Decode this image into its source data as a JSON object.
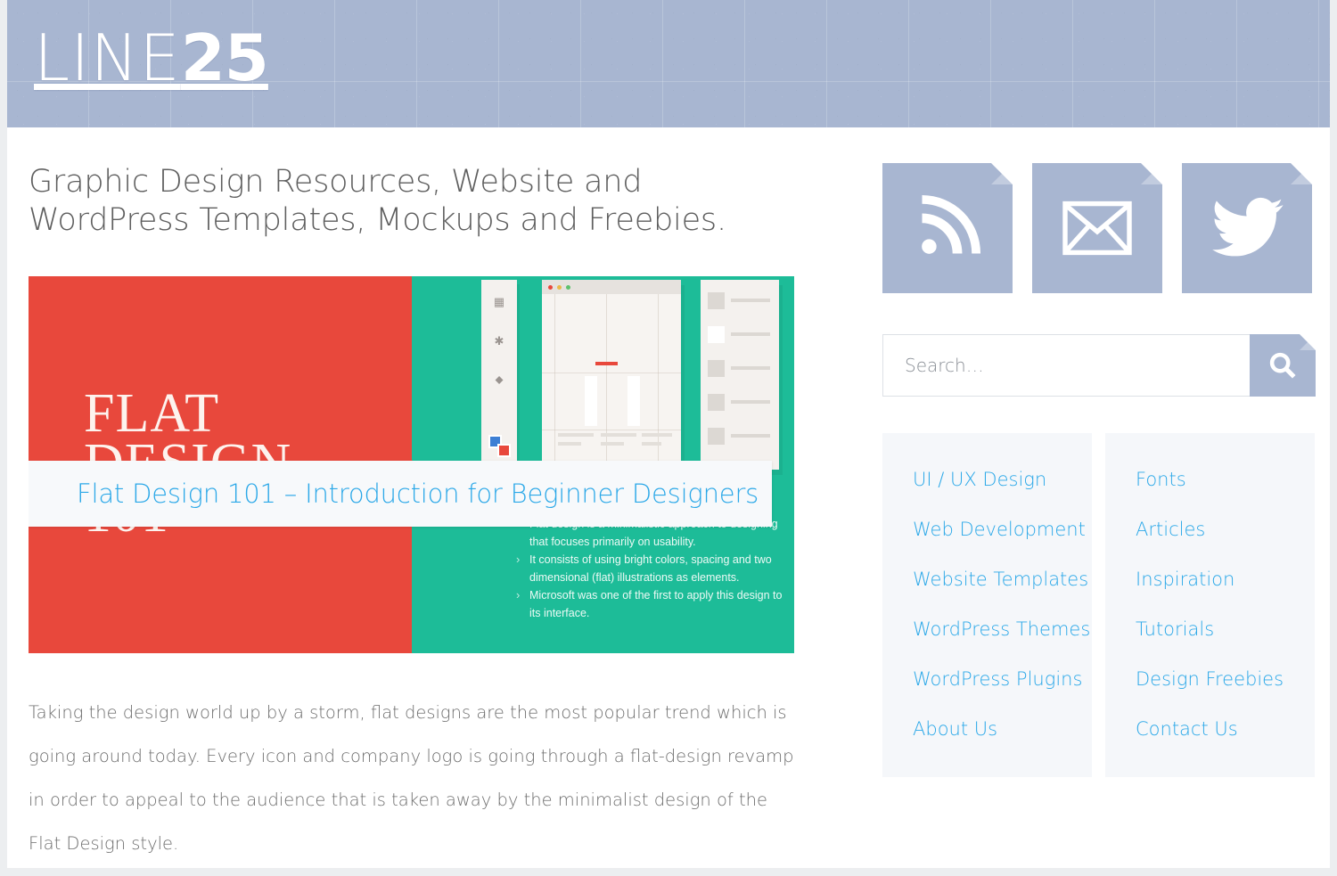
{
  "header": {
    "logo_light": "LINE",
    "logo_bold": "25",
    "bg_color": "#a8b6d1"
  },
  "main": {
    "page_title": "Graphic Design Resources, Website and WordPress Templates, Mockups and Freebies.",
    "featured": {
      "headline_line1": "FLAT",
      "headline_line2": "DESIGN",
      "headline_line3": "101",
      "red_color": "#e8483c",
      "teal_color": "#1dbc98",
      "bullets": [
        "Flat design is a minimalistic approach to designing that focuses primarily on usability.",
        "It consists of using bright colors, spacing and two dimensional (flat) illustrations as elements.",
        "Microsoft was one of the first to apply this design to its interface."
      ],
      "post_title": "Flat Design 101 – Introduction for Beginner Designers",
      "link_color": "#2ba8e8"
    },
    "excerpt": "Taking the design world up by a storm, flat designs are the most popular trend which is going around today. Every icon and company logo is going through a flat-design revamp in order to appeal to the audience that is taken away by the minimalist design of the Flat Design style."
  },
  "sidebar": {
    "social": [
      {
        "name": "rss-icon",
        "label": "RSS Feed"
      },
      {
        "name": "email-icon",
        "label": "Email Newsletter"
      },
      {
        "name": "twitter-icon",
        "label": "Twitter"
      }
    ],
    "search": {
      "placeholder": "Search…",
      "value": "",
      "button_icon": "search-icon"
    },
    "categories_left": [
      "UI / UX Design",
      "Web Development",
      "Website Templates",
      "WordPress Themes",
      "WordPress Plugins",
      "About Us"
    ],
    "categories_right": [
      "Fonts",
      "Articles",
      "Inspiration",
      "Tutorials",
      "Design Freebies",
      "Contact Us"
    ]
  }
}
